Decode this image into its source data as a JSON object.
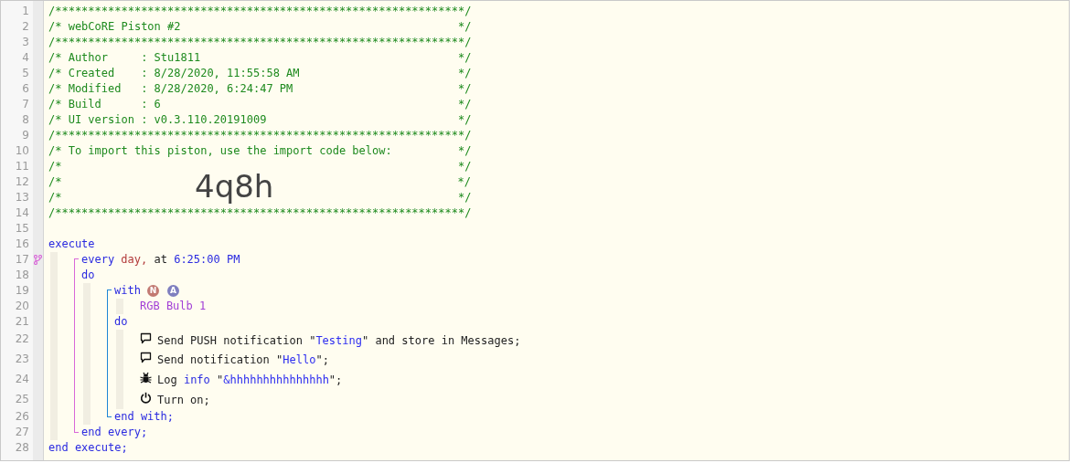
{
  "line_numbers": [
    "1",
    "2",
    "3",
    "4",
    "5",
    "6",
    "7",
    "8",
    "9",
    "10",
    "11",
    "12",
    "13",
    "14",
    "15",
    "16",
    "17",
    "18",
    "19",
    "20",
    "21",
    "22",
    "23",
    "24",
    "25",
    "26",
    "27",
    "28"
  ],
  "header": [
    {
      "kind": "comment",
      "text": "/**************************************************************/"
    },
    {
      "kind": "comment",
      "text": "/* webCoRE Piston #2                                          */"
    },
    {
      "kind": "comment",
      "text": "/**************************************************************/"
    },
    {
      "kind": "comment",
      "text": "/* Author     : Stu1811                                       */"
    },
    {
      "kind": "comment",
      "text": "/* Created    : 8/28/2020, 11:55:58 AM                        */"
    },
    {
      "kind": "comment",
      "text": "/* Modified   : 8/28/2020, 6:24:47 PM                         */"
    },
    {
      "kind": "comment",
      "text": "/* Build      : 6                                             */"
    },
    {
      "kind": "comment",
      "text": "/* UI version : v0.3.110.20191009                             */"
    },
    {
      "kind": "comment",
      "text": "/**************************************************************/"
    },
    {
      "kind": "comment",
      "text": "/* To import this piston, use the import code below:          */"
    },
    {
      "kind": "comment",
      "text": "/*                                                            */"
    },
    {
      "kind": "import",
      "prefix": "/*",
      "code": "4q8h",
      "suffix": "*/"
    },
    {
      "kind": "comment",
      "text": "/*                                                            */"
    },
    {
      "kind": "comment",
      "text": "/**************************************************************/"
    }
  ],
  "code": {
    "open": [
      {
        "text": "execute",
        "kind": "keyword"
      }
    ],
    "children": [
      {
        "kind": "every",
        "open": [
          {
            "text": "every ",
            "kind": "keyword"
          },
          {
            "text": "day,",
            "kind": "value"
          },
          {
            "text": " at ",
            "kind": "plain"
          },
          {
            "text": "6:25:00 PM",
            "kind": "keyword"
          }
        ],
        "do": "do",
        "children": [
          {
            "kind": "with",
            "open": [
              {
                "text": "with",
                "kind": "keyword"
              }
            ],
            "badges": [
              {
                "text": "N",
                "color": "#c27a72"
              },
              {
                "text": "A",
                "color": "#7f7fbf"
              }
            ],
            "devices": [
              [
                {
                  "text": "RGB Bulb 1",
                  "kind": "device"
                }
              ]
            ],
            "do": "do",
            "statements": [
              {
                "kind": "notification",
                "tokens": [
                  {
                    "text": "Send PUSH notification \"",
                    "kind": "plain"
                  },
                  {
                    "text": "Testing",
                    "kind": "string"
                  },
                  {
                    "text": "\" and store in Messages;",
                    "kind": "plain"
                  }
                ]
              },
              {
                "kind": "notification",
                "tokens": [
                  {
                    "text": "Send notification \"",
                    "kind": "plain"
                  },
                  {
                    "text": "Hello",
                    "kind": "string"
                  },
                  {
                    "text": "\";",
                    "kind": "plain"
                  }
                ]
              },
              {
                "kind": "log",
                "tokens": [
                  {
                    "text": "Log ",
                    "kind": "plain"
                  },
                  {
                    "text": "info",
                    "kind": "keyword"
                  },
                  {
                    "text": " \"",
                    "kind": "plain"
                  },
                  {
                    "text": "&hhhhhhhhhhhhhhh",
                    "kind": "string"
                  },
                  {
                    "text": "\";",
                    "kind": "plain"
                  }
                ]
              },
              {
                "kind": "command",
                "tokens": [
                  {
                    "text": "Turn on;",
                    "kind": "plain"
                  }
                ]
              }
            ],
            "close": [
              {
                "text": "end with;",
                "kind": "keyword"
              }
            ]
          }
        ],
        "close": [
          {
            "text": "end every;",
            "kind": "keyword"
          }
        ]
      }
    ],
    "close": [
      {
        "text": "end execute;",
        "kind": "keyword"
      }
    ]
  }
}
